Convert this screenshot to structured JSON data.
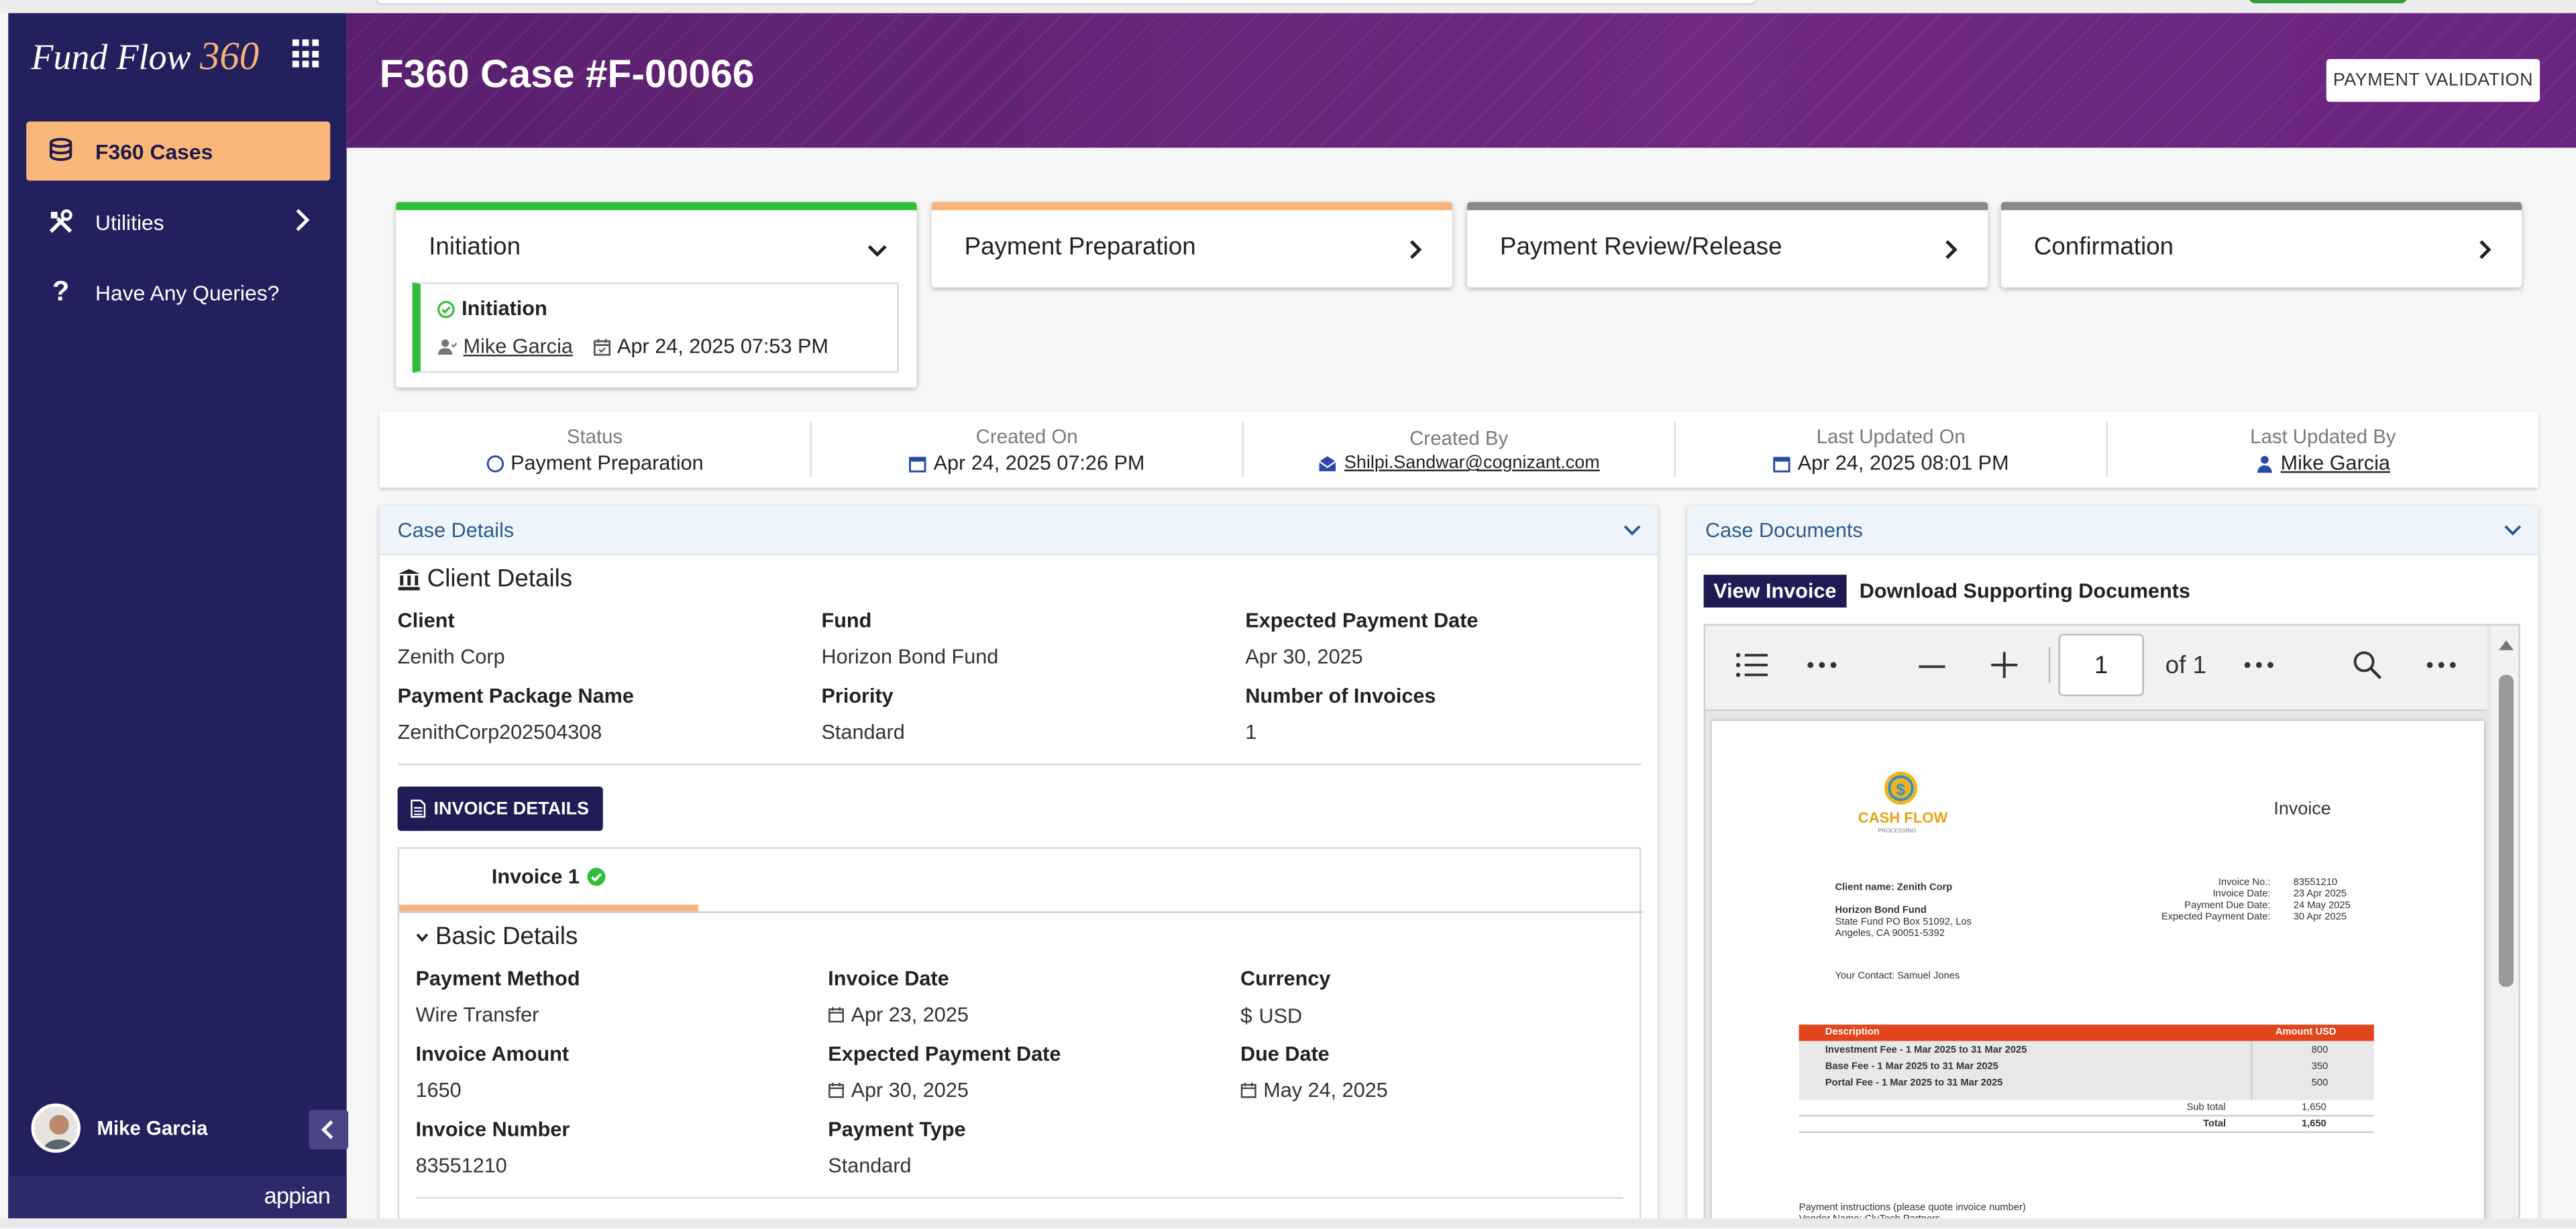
{
  "app": {
    "logo_text": "Fund Flow",
    "logo_num": "360",
    "apps_icon": "grid-icon"
  },
  "sidebar": {
    "items": [
      {
        "label": "F360 Cases",
        "icon": "coins-icon",
        "active": true
      },
      {
        "label": "Utilities",
        "icon": "tools-icon"
      },
      {
        "label": "Have Any Queries?",
        "icon": "question-icon"
      }
    ],
    "user_name": "Mike Garcia",
    "brand": "appian"
  },
  "header": {
    "title": "F360 Case #F-00066",
    "action_button": "PAYMENT VALIDATION"
  },
  "stages": [
    {
      "label": "Initiation",
      "color": "#2ebf3a",
      "expanded": true
    },
    {
      "label": "Payment Preparation",
      "color": "#f8b47c"
    },
    {
      "label": "Payment Review/Release",
      "color": "#888888"
    },
    {
      "label": "Confirmation",
      "color": "#888888"
    }
  ],
  "initiation_detail": {
    "title": "Initiation",
    "user": "Mike Garcia",
    "datetime": "Apr 24, 2025 07:53 PM"
  },
  "summary": [
    {
      "label": "Status",
      "value": "Payment Preparation"
    },
    {
      "label": "Created On",
      "value": "Apr 24, 2025 07:26 PM"
    },
    {
      "label": "Created By",
      "value": "Shilpi.Sandwar@cognizant.com"
    },
    {
      "label": "Last Updated On",
      "value": "Apr 24, 2025 08:01 PM"
    },
    {
      "label": "Last Updated By",
      "value": "Mike Garcia"
    }
  ],
  "case_details": {
    "panel_title": "Case Details",
    "section_title": "Client Details",
    "fields": [
      {
        "label": "Client",
        "value": "Zenith Corp"
      },
      {
        "label": "Fund",
        "value": "Horizon Bond Fund"
      },
      {
        "label": "Expected Payment Date",
        "value": "Apr 30, 2025"
      },
      {
        "label": "Payment Package Name",
        "value": "ZenithCorp202504308"
      },
      {
        "label": "Priority",
        "value": "Standard"
      },
      {
        "label": "Number of Invoices",
        "value": "1"
      }
    ],
    "invoice_button": "INVOICE DETAILS",
    "invoice_tab": "Invoice 1",
    "basic_title": "Basic Details",
    "basic_fields": [
      {
        "label": "Payment Method",
        "value": "Wire Transfer"
      },
      {
        "label": "Invoice Date",
        "value": "Apr 23, 2025"
      },
      {
        "label": "Currency",
        "value": "USD"
      },
      {
        "label": "Invoice Amount",
        "value": "1650"
      },
      {
        "label": "Expected Payment Date",
        "value": "Apr 30, 2025"
      },
      {
        "label": "Due Date",
        "value": "May 24, 2025"
      },
      {
        "label": "Invoice Number",
        "value": "83551210"
      },
      {
        "label": "Payment Type",
        "value": "Standard"
      }
    ]
  },
  "case_documents": {
    "panel_title": "Case Documents",
    "tab_active": "View Invoice",
    "tab_other": "Download Supporting Documents",
    "viewer": {
      "page_value": "1",
      "page_of": "of 1"
    },
    "invoice_doc": {
      "brand": "CASH FLOW",
      "brand_sub": "PROCESSING",
      "heading": "Invoice",
      "client_line": "Client name: Zenith Corp",
      "fund_line": "Horizon Bond Fund",
      "addr1": "State Fund PO Box 51092, Los",
      "addr2": "Angeles, CA 90051-5392",
      "meta_labels": [
        "Invoice No.:",
        "Invoice Date:",
        "Payment Due Date:",
        "Expected Payment Date:"
      ],
      "meta_values": [
        "83551210",
        "23 Apr 2025",
        "24 May 2025",
        "30 Apr 2025"
      ],
      "contact": "Your Contact: Samuel Jones",
      "col_desc": "Description",
      "col_amt": "Amount USD",
      "rows": [
        {
          "desc": "Investment Fee - 1 Mar 2025 to 31 Mar 2025",
          "amt": "800"
        },
        {
          "desc": "Base Fee   - 1 Mar 2025 to 31 Mar 2025",
          "amt": "350"
        },
        {
          "desc": "Portal Fee - 1 Mar 2025 to 31 Mar 2025",
          "amt": "500"
        }
      ],
      "subtotal_label": "Sub total",
      "subtotal": "1,650",
      "total_label": "Total",
      "total": "1,650",
      "footer1": "Payment instructions (please quote invoice number)",
      "footer2": "Vendor Name: CluTech Partners"
    }
  }
}
